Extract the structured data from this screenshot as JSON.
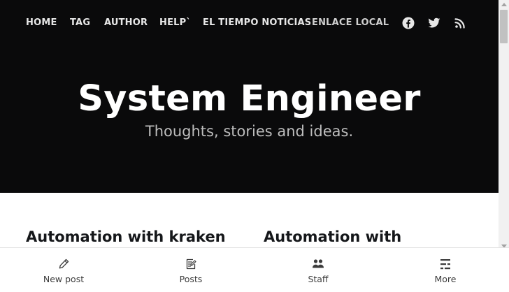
{
  "nav": {
    "items": [
      {
        "label": "HOME"
      },
      {
        "label": "TAG"
      },
      {
        "label": "AUTHOR"
      },
      {
        "label": "HELP`"
      },
      {
        "label": "EL TIEMPO NOTICIAS"
      },
      {
        "label": "ENLACE LOCAL"
      }
    ],
    "social": [
      {
        "icon": "facebook-icon"
      },
      {
        "icon": "twitter-icon"
      },
      {
        "icon": "rss-icon"
      }
    ]
  },
  "header": {
    "title": "System Engineer",
    "description": "Thoughts, stories and ideas."
  },
  "posts": [
    {
      "title": "Automation with kraken"
    },
    {
      "title": "Automation with"
    }
  ],
  "bottom_bar": {
    "items": [
      {
        "label": "New post",
        "icon": "pencil-icon"
      },
      {
        "label": "Posts",
        "icon": "edit-document-icon"
      },
      {
        "label": "Staff",
        "icon": "staff-icon"
      },
      {
        "label": "More",
        "icon": "more-icon"
      }
    ]
  },
  "colors": {
    "hero_background": "#0a0a0b",
    "title_text": "#ffffff",
    "description_text": "#bdbdbd",
    "post_title_text": "#15171a"
  }
}
